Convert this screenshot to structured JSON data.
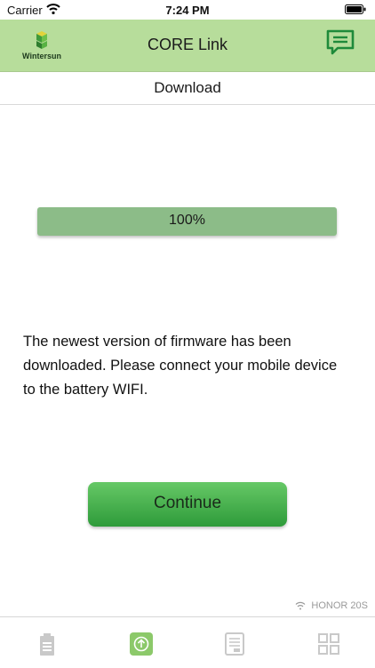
{
  "status_bar": {
    "carrier": "Carrier",
    "time": "7:24 PM"
  },
  "header": {
    "logo_text": "Wintersun",
    "title": "CORE Link"
  },
  "page": {
    "title": "Download"
  },
  "progress": {
    "value": 100,
    "label": "100%"
  },
  "message": "The newest version of firmware has been downloaded. Please connect your mobile device to the battery WIFI.",
  "continue_button": {
    "label": "Continue"
  },
  "wifi": {
    "name": "HONOR 20S"
  },
  "nav": {
    "items": [
      {
        "icon": "battery-icon",
        "active": false
      },
      {
        "icon": "upgrade-icon",
        "active": true
      },
      {
        "icon": "log-icon",
        "active": false
      },
      {
        "icon": "grid-icon",
        "active": false
      }
    ]
  },
  "colors": {
    "header_bg": "#b7dd9b",
    "progress_fill": "#8cbc88",
    "button_green": "#3fae46",
    "active_nav": "#8cc96a",
    "inactive_nav": "#c9c9c9"
  }
}
